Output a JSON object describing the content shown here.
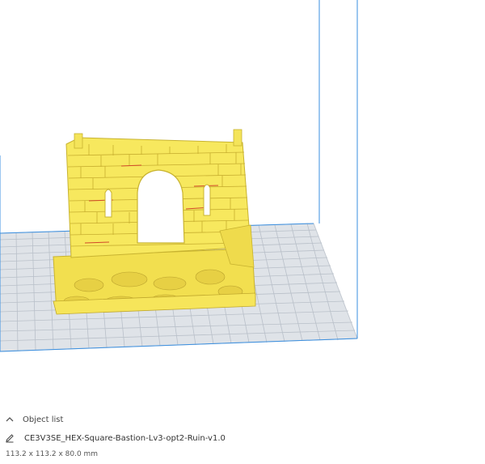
{
  "object_list": {
    "title": "Object list",
    "expand_icon": "chevron-up-icon",
    "object_name": "CE3V3SE_HEX-Square-Bastion-Lv3-opt2-Ruin-v1.0",
    "edit_icon": "pencil-icon",
    "dimensions": "113.2 x 113.2 x 80.0 mm"
  },
  "colors": {
    "model": "#f4e96a",
    "model_shadow": "#d6c43c",
    "build_plate": "#dfe3e8",
    "grid_line": "#b9c0c9",
    "volume_edge": "#3a8fe0"
  }
}
